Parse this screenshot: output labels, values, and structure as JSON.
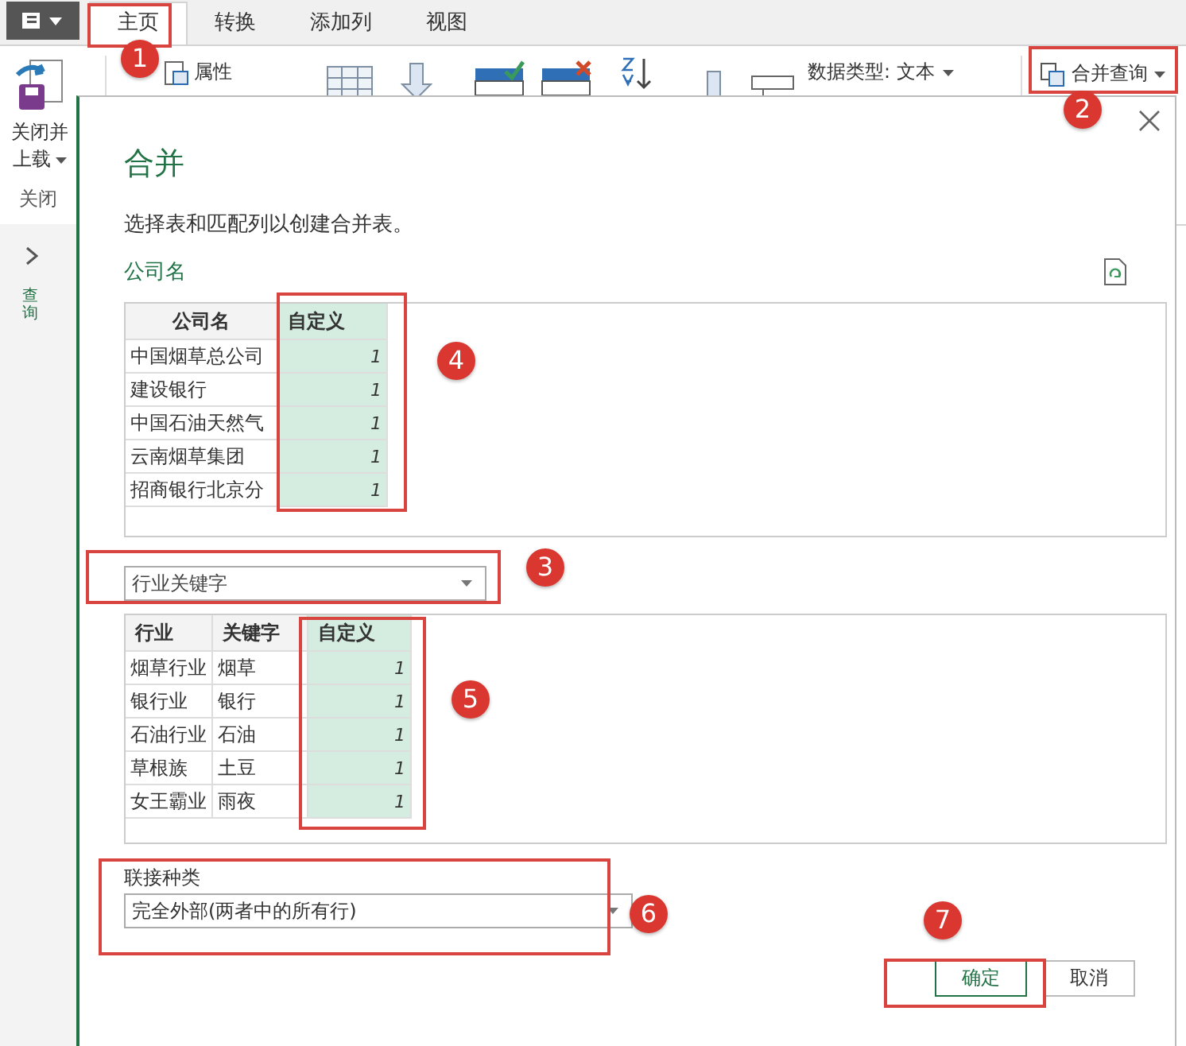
{
  "tabs": [
    {
      "label": "主页",
      "selected": true
    },
    {
      "label": "转换",
      "selected": false
    },
    {
      "label": "添加列",
      "selected": false
    },
    {
      "label": "视图",
      "selected": false
    }
  ],
  "ribbon": {
    "close_load": [
      "关闭并",
      "上载"
    ],
    "group_label": "关闭",
    "properties": "属性",
    "data_type": "数据类型: 文本",
    "merge_queries": "合并查询"
  },
  "left_pane": {
    "vertical_label": "查询"
  },
  "dialog": {
    "title": "合并",
    "description": "选择表和匹配列以创建合并表。",
    "first_table_label": "公司名",
    "first_table": {
      "columns": [
        "公司名",
        "自定义"
      ],
      "rows": [
        [
          "中国烟草总公司",
          "1"
        ],
        [
          "建设银行",
          "1"
        ],
        [
          "中国石油天然气",
          "1"
        ],
        [
          "云南烟草集团",
          "1"
        ],
        [
          "招商银行北京分",
          "1"
        ]
      ]
    },
    "second_table_selector": "行业关键字",
    "second_table": {
      "columns": [
        "行业",
        "关键字",
        "自定义"
      ],
      "rows": [
        [
          "烟草行业",
          "烟草",
          "1"
        ],
        [
          "银行业",
          "银行",
          "1"
        ],
        [
          "石油行业",
          "石油",
          "1"
        ],
        [
          "草根族",
          "土豆",
          "1"
        ],
        [
          "女王霸业",
          "雨夜",
          "1"
        ]
      ]
    },
    "join": {
      "label": "联接种类",
      "value": "完全外部(两者中的所有行)"
    },
    "buttons": [
      {
        "label": "确定",
        "kind": "primary"
      },
      {
        "label": "取消",
        "kind": "secondary"
      }
    ]
  },
  "annotations": [
    {
      "label": "1"
    },
    {
      "label": "2"
    },
    {
      "label": "3"
    },
    {
      "label": "4"
    },
    {
      "label": "5"
    },
    {
      "label": "6"
    },
    {
      "label": "7"
    }
  ]
}
